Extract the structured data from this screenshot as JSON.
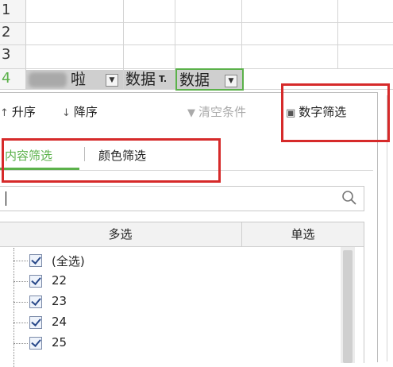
{
  "sheet": {
    "rows": [
      "1",
      "2",
      "3",
      "4"
    ],
    "header_cells": [
      {
        "label": "啦",
        "has_dropdown": true
      },
      {
        "label": "数据",
        "has_dropdown": false,
        "filter_icon": "T."
      },
      {
        "label": "数据",
        "has_dropdown": true,
        "selected": true
      }
    ]
  },
  "toolbar": {
    "sort_asc": "升序",
    "sort_desc": "降序",
    "clear": "清空条件",
    "number_filter": "数字筛选"
  },
  "tabs": {
    "content_filter": "内容筛选",
    "color_filter": "颜色筛选",
    "active": "content_filter"
  },
  "search": {
    "value": "",
    "placeholder": ""
  },
  "list": {
    "col_multi": "多选",
    "col_single": "单选",
    "items": [
      {
        "label": "(全选)",
        "checked": true
      },
      {
        "label": "22",
        "checked": true
      },
      {
        "label": "23",
        "checked": true
      },
      {
        "label": "24",
        "checked": true
      },
      {
        "label": "25",
        "checked": true
      }
    ]
  },
  "colors": {
    "accent": "#5bb14a",
    "highlight": "#d62a2a",
    "header_fill": "#cfcfcf"
  }
}
